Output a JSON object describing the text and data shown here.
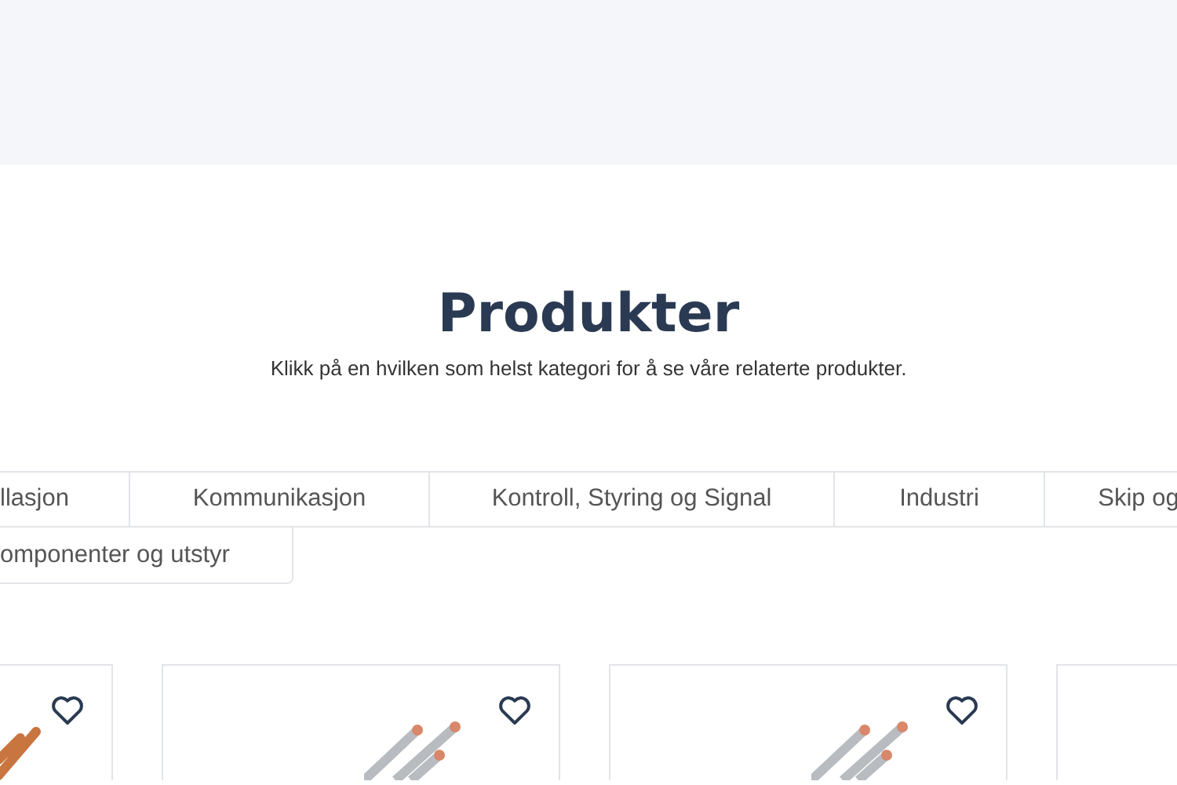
{
  "title": "Produkter",
  "subtitle": "Klikk på en hvilken som helst kategori for å se våre relaterte produkter.",
  "categories": [
    {
      "label": "llasjon"
    },
    {
      "label": "Kommunikasjon"
    },
    {
      "label": "Kontroll, Styring og Signal"
    },
    {
      "label": "Industri"
    },
    {
      "label": "Skip og"
    },
    {
      "label": "omponenter og utstyr"
    }
  ],
  "products": [
    {
      "kind": "copper"
    },
    {
      "kind": "steel"
    },
    {
      "kind": "steel"
    },
    {
      "kind": "blank"
    }
  ]
}
